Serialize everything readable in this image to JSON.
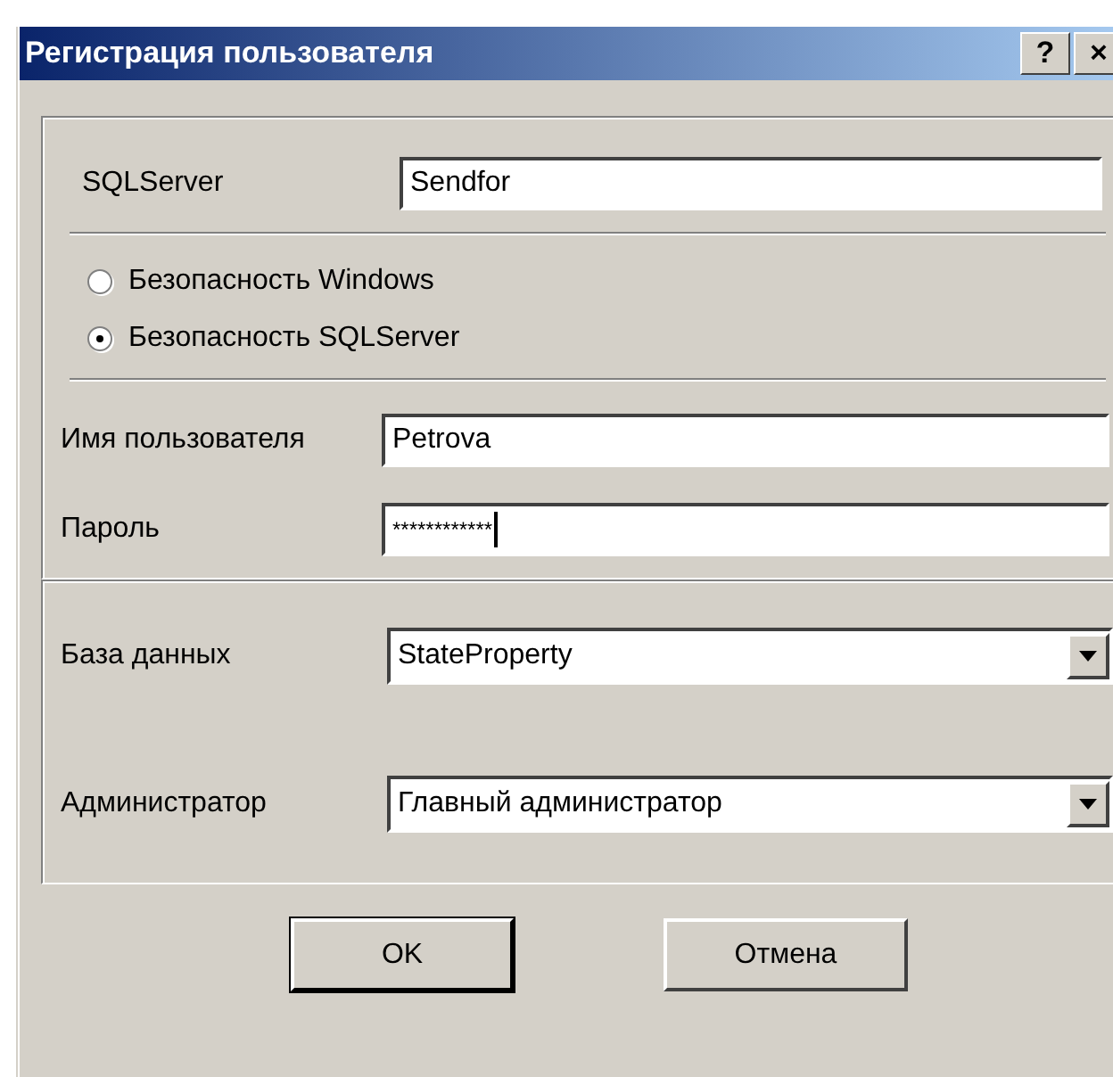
{
  "window": {
    "title": "Регистрация пользователя",
    "title_buttons": [
      "?",
      "×"
    ]
  },
  "server": {
    "label": "SQLServer",
    "value": "Sendfor"
  },
  "security": [
    {
      "label": "Безопасность Windows",
      "selected": false
    },
    {
      "label": "Безопасность SQLServer",
      "selected": true
    }
  ],
  "user": {
    "label": "Имя пользователя",
    "value": "Petrova"
  },
  "password": {
    "label": "Пароль",
    "value": "************",
    "focused": true
  },
  "database": {
    "label": "База данных",
    "value": "StateProperty"
  },
  "administrator": {
    "label": "Администратор",
    "value": "Главный администратор"
  },
  "buttons": [
    {
      "label": "OK",
      "default": true
    },
    {
      "label": "Отмена",
      "default": false
    }
  ]
}
